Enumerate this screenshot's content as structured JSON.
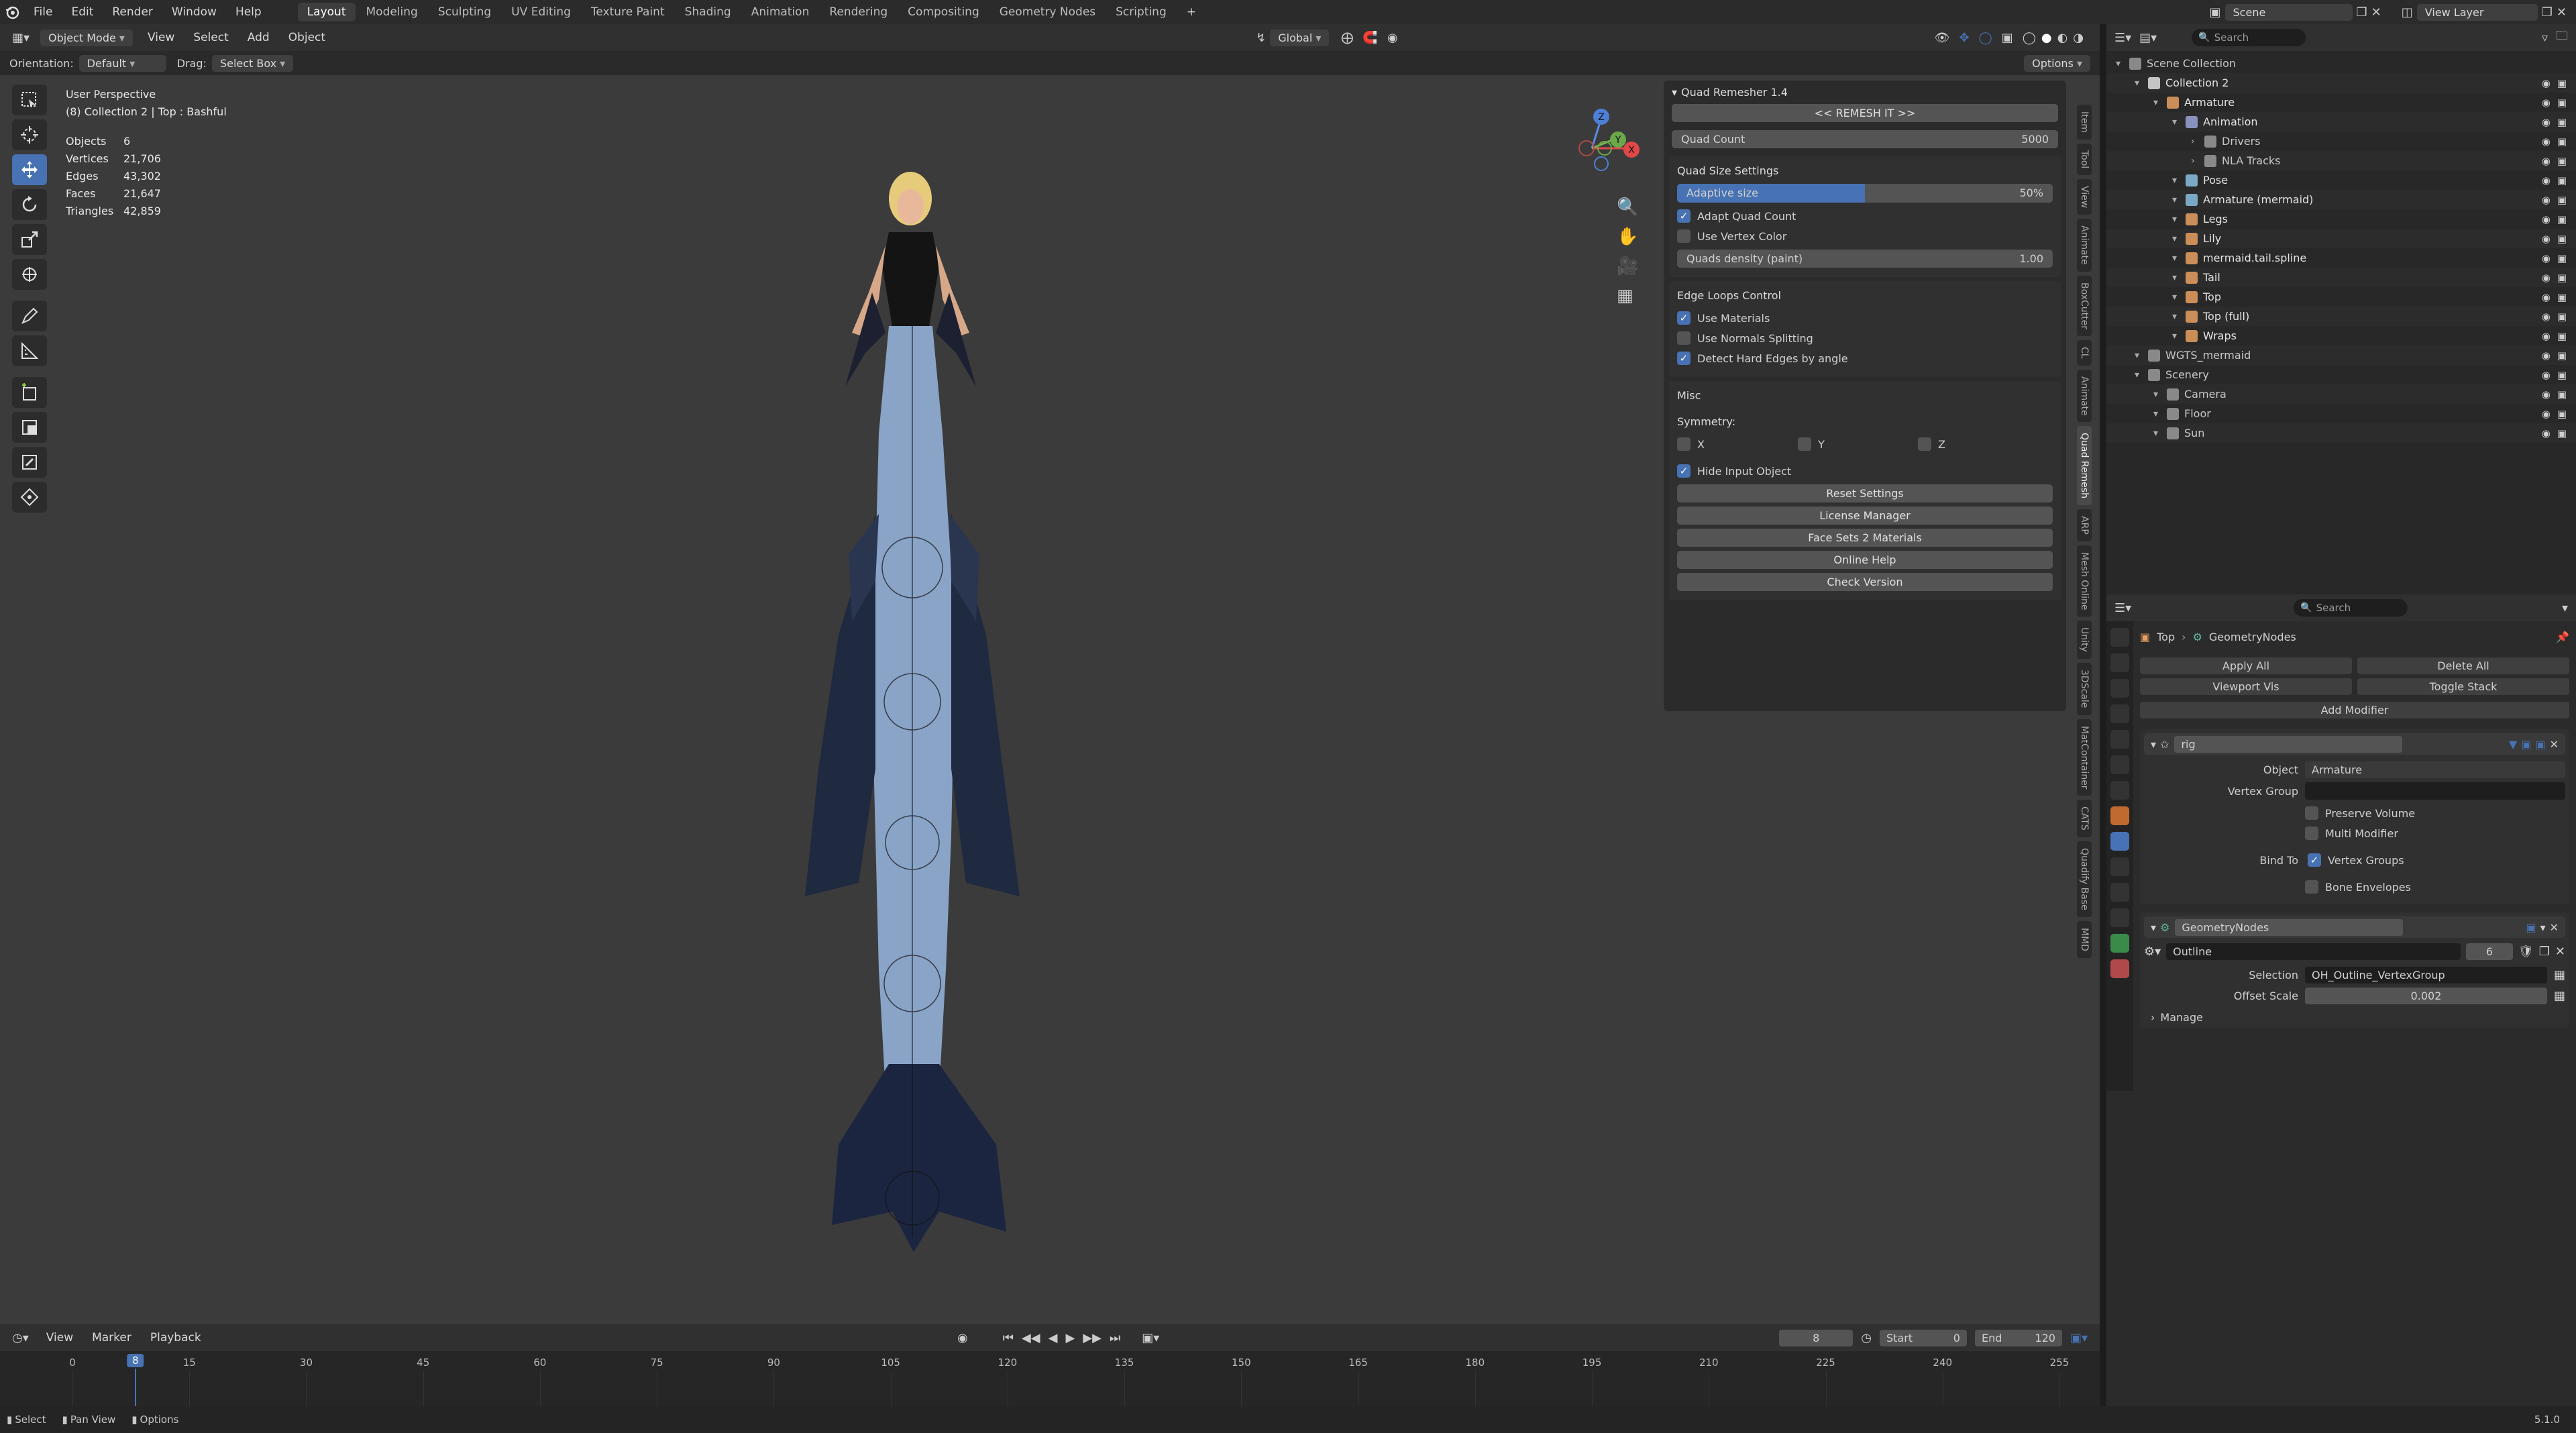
{
  "topbar": {
    "menus": [
      "File",
      "Edit",
      "Render",
      "Window",
      "Help"
    ],
    "workspaces": [
      "Layout",
      "Modeling",
      "Sculpting",
      "UV Editing",
      "Texture Paint",
      "Shading",
      "Animation",
      "Rendering",
      "Compositing",
      "Geometry Nodes",
      "Scripting"
    ],
    "active_workspace": "Layout",
    "add_tab": "+",
    "scene": "Scene",
    "view_layer": "View Layer"
  },
  "viewport_header": {
    "mode": "Object Mode",
    "menus": [
      "View",
      "Select",
      "Add",
      "Object"
    ],
    "transform": "Global",
    "orientation_label": "Orientation:",
    "orientation_value": "Default",
    "drag_label": "Drag:",
    "drag_value": "Select Box",
    "options": "Options"
  },
  "viewport_info": {
    "perspective": "User Perspective",
    "context": "(8) Collection 2 | Top : Bashful",
    "stats": [
      {
        "label": "Objects",
        "value": "6"
      },
      {
        "label": "Vertices",
        "value": "21,706"
      },
      {
        "label": "Edges",
        "value": "43,302"
      },
      {
        "label": "Faces",
        "value": "21,647"
      },
      {
        "label": "Triangles",
        "value": "42,859"
      }
    ]
  },
  "gizmo": {
    "x": "X",
    "y": "Y",
    "z": "Z"
  },
  "quad_remesher": {
    "title": "Quad Remesher 1.4",
    "remesh_button": "<< REMESH IT >>",
    "quad_count_label": "Quad Count",
    "quad_count_value": "5000",
    "size_settings_title": "Quad Size Settings",
    "adaptive_size_label": "Adaptive size",
    "adaptive_size_value": "50%",
    "adaptive_size_fraction": 0.5,
    "adapt_quad_count": "Adapt Quad Count",
    "use_vertex_color": "Use Vertex Color",
    "quads_density_label": "Quads density (paint)",
    "quads_density_value": "1.00",
    "edge_loops_title": "Edge Loops Control",
    "use_materials": "Use Materials",
    "use_normals_splitting": "Use Normals Splitting",
    "detect_hard_edges": "Detect Hard Edges by angle",
    "misc_title": "Misc",
    "symmetry_label": "Symmetry:",
    "sym_x": "X",
    "sym_y": "Y",
    "sym_z": "Z",
    "hide_input_object": "Hide Input Object",
    "reset_settings": "Reset Settings",
    "license_manager": "License Manager",
    "face_sets": "Face Sets 2 Materials",
    "online_help": "Online Help",
    "check_version": "Check Version"
  },
  "side_tabs": [
    "Item",
    "Tool",
    "View",
    "Animate",
    "BoxCutter",
    "CL",
    "Animate",
    "Quad Remesh",
    "ARP",
    "Mesh Online",
    "Unity",
    "3DScale",
    "MatContainer",
    "CATS",
    "Quadify Base",
    "MMD"
  ],
  "active_side_tab": "Quad Remesh",
  "outliner": {
    "search_placeholder": "Search",
    "rows": [
      {
        "label": "Scene Collection",
        "indent": 0,
        "color": "#9a9a9a"
      },
      {
        "label": "Collection 2",
        "indent": 1,
        "color": "#e0e0e0"
      },
      {
        "label": "Armature",
        "indent": 2,
        "color": "#e8a060"
      },
      {
        "label": "Animation",
        "indent": 3,
        "color": "#9aa4d8"
      },
      {
        "label": "Drivers",
        "indent": 4,
        "color": "#9a9a9a"
      },
      {
        "label": "NLA Tracks",
        "indent": 4,
        "color": "#9a9a9a"
      },
      {
        "label": "Pose",
        "indent": 3,
        "color": "#8ac0e0"
      },
      {
        "label": "Armature (mermaid)",
        "indent": 3,
        "color": "#8ac0e0"
      },
      {
        "label": "Legs",
        "indent": 3,
        "color": "#e8a060"
      },
      {
        "label": "Lily",
        "indent": 3,
        "color": "#e8a060"
      },
      {
        "label": "mermaid.tail.spline",
        "indent": 3,
        "color": "#e8a060"
      },
      {
        "label": "Tail",
        "indent": 3,
        "color": "#e8a060"
      },
      {
        "label": "Top",
        "indent": 3,
        "color": "#e8a060"
      },
      {
        "label": "Top (full)",
        "indent": 3,
        "color": "#e8a060"
      },
      {
        "label": "Wraps",
        "indent": 3,
        "color": "#e8a060"
      },
      {
        "label": "WGTS_mermaid",
        "indent": 1,
        "color": "#9a9a9a"
      },
      {
        "label": "Scenery",
        "indent": 1,
        "color": "#9a9a9a"
      },
      {
        "label": "Camera",
        "indent": 2,
        "color": "#9a9a9a"
      },
      {
        "label": "Floor",
        "indent": 2,
        "color": "#9a9a9a"
      },
      {
        "label": "Sun",
        "indent": 2,
        "color": "#9a9a9a"
      }
    ]
  },
  "properties": {
    "search_placeholder": "Search",
    "breadcrumb_object": "Top",
    "breadcrumb_modifier": "GeometryNodes",
    "apply_all": "Apply All",
    "delete_all": "Delete All",
    "viewport_vis": "Viewport Vis",
    "toggle_stack": "Toggle Stack",
    "add_modifier": "Add Modifier",
    "rig": {
      "name": "rig",
      "object_label": "Object",
      "object_value": "Armature",
      "vertex_group_label": "Vertex Group",
      "preserve_volume": "Preserve Volume",
      "multi_modifier": "Multi Modifier",
      "bind_to_label": "Bind To",
      "vertex_groups": "Vertex Groups",
      "bone_envelopes": "Bone Envelopes"
    },
    "geonodes": {
      "name": "GeometryNodes",
      "node_group": "Outline",
      "users": "6",
      "selection_label": "Selection",
      "selection_value": "OH_Outline_VertexGroup",
      "offset_scale_label": "Offset Scale",
      "offset_scale_value": "0.002",
      "manage": "Manage"
    }
  },
  "timeline": {
    "menus": [
      "View",
      "Marker",
      "Playback"
    ],
    "current_frame": "8",
    "start_label": "Start",
    "start_value": "0",
    "end_label": "End",
    "end_value": "120",
    "ticks": [
      "0",
      "15",
      "30",
      "45",
      "60",
      "75",
      "90",
      "105",
      "120",
      "135",
      "150",
      "165",
      "180",
      "195",
      "210",
      "225",
      "240",
      "255"
    ]
  },
  "statusbar": {
    "select": "Select",
    "pan_view": "Pan View",
    "options": "Options",
    "version": "5.1.0"
  },
  "colors": {
    "accent": "#4772b3",
    "header_bg": "#2b2b2b",
    "viewport_bg": "#3b3b3b"
  }
}
